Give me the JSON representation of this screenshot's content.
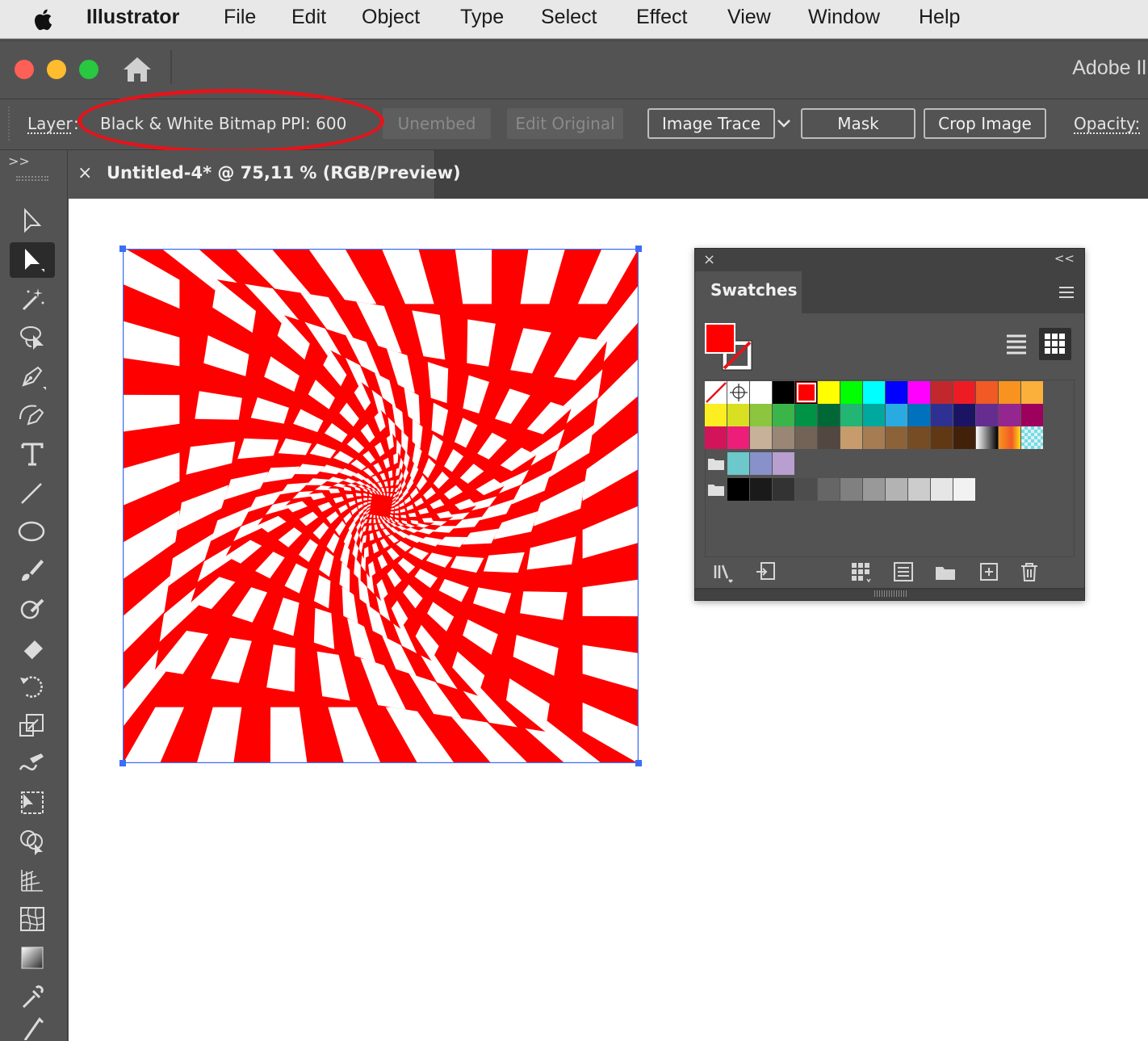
{
  "menubar": {
    "apple_icon": "apple-logo",
    "app_name": "Illustrator",
    "items": [
      "File",
      "Edit",
      "Object",
      "Type",
      "Select",
      "Effect",
      "View",
      "Window",
      "Help"
    ]
  },
  "window": {
    "title": "Adobe Il",
    "traffic_colors": [
      "#fe5f57",
      "#febc2e",
      "#28c840"
    ]
  },
  "control_bar": {
    "layer_label": "Layer",
    "layer_tail": ":",
    "image_type": "Black & White Bitmap",
    "ppi": "PPI: 600",
    "unembed_label": "Unembed",
    "edit_original_label": "Edit Original",
    "image_trace_label": "Image Trace",
    "mask_label": "Mask",
    "crop_image_label": "Crop Image",
    "opacity_label": "Opacity:",
    "highlight_color": "#e4141b"
  },
  "toolbox": {
    "collapse_label": ">>",
    "tools": [
      "selection-tool-icon",
      "direct-selection-tool-icon",
      "magic-wand-tool-icon",
      "lasso-tool-icon",
      "pen-tool-icon",
      "curvature-tool-icon",
      "type-tool-icon",
      "line-segment-tool-icon",
      "ellipse-tool-icon",
      "paintbrush-tool-icon",
      "shaper-tool-icon",
      "eraser-tool-icon",
      "rotate-tool-icon",
      "scale-tool-icon",
      "warp-tool-icon",
      "free-transform-tool-icon",
      "shape-builder-tool-icon",
      "perspective-grid-tool-icon",
      "mesh-tool-icon",
      "gradient-tool-icon",
      "eyedropper-tool-icon"
    ],
    "selected_tool": "direct-selection-tool-icon"
  },
  "document": {
    "tab_close": "×",
    "tab_title": "Untitled-4* @ 75,11 % (RGB/Preview)",
    "artwork_colors": [
      "#ff0000",
      "#ffffff"
    ],
    "selection_color": "#3b6ef5"
  },
  "swatches": {
    "close_label": "×",
    "collapse_label": "<<",
    "title": "Swatches",
    "fill_color": "#ff0000",
    "rows": [
      [
        "none",
        "registration",
        "#ffffff",
        "#000000",
        "#ff0000",
        "#ffff00",
        "#00ff00",
        "#00ffff",
        "#0000ff",
        "#ff00ff",
        "#c1272d",
        "#ed1c24",
        "#f15a24",
        "#f7931e",
        "#fbb03b"
      ],
      [
        "#fcee21",
        "#d9e021",
        "#8cc63f",
        "#39b54a",
        "#009245",
        "#006837",
        "#22b573",
        "#00a99d",
        "#29abe2",
        "#0071bc",
        "#2e3192",
        "#1b1464",
        "#662d91",
        "#93278f",
        "#9e005d"
      ],
      [
        "#d4145a",
        "#ed1e79",
        "#c7b299",
        "#998675",
        "#736357",
        "#534741",
        "#c69c6d",
        "#a67c52",
        "#8c6239",
        "#754c24",
        "#603813",
        "#42210b",
        "gradient-bw",
        "gradient-orange",
        "pattern"
      ],
      [
        "folder",
        "#6cc8cb",
        "#8891c9",
        "#b89fcf"
      ],
      [
        "folder",
        "#000000",
        "#1a1a1a",
        "#333333",
        "#4d4d4d",
        "#666666",
        "#808080",
        "#999999",
        "#b3b3b3",
        "#cccccc",
        "#e6e6e6",
        "#f2f2f2"
      ]
    ],
    "footer_icons": [
      "swatch-libraries-icon",
      "place-swatches-icon",
      "show-kinds-icon",
      "swatch-options-icon",
      "new-color-group-icon",
      "new-swatch-icon",
      "delete-swatch-icon"
    ]
  }
}
